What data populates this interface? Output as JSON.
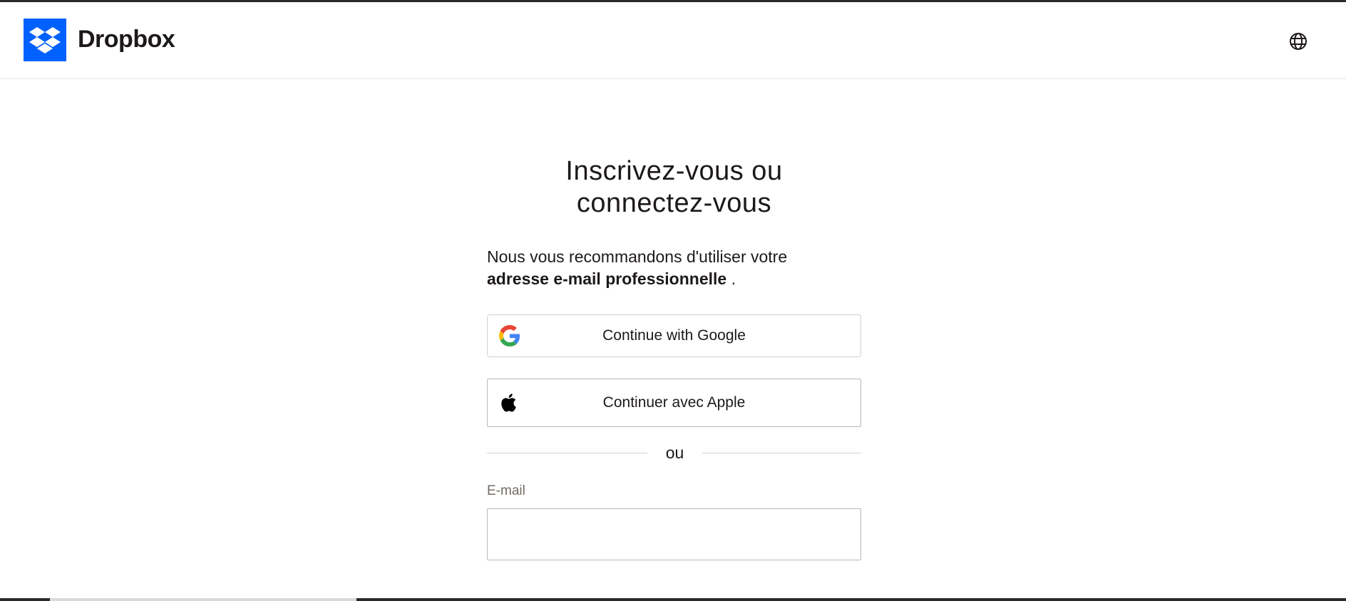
{
  "header": {
    "brand": "Dropbox",
    "logo_icon": "dropbox-logo-icon",
    "language_icon": "globe-icon",
    "brand_color": "#0061fe"
  },
  "main": {
    "title_line1": "Inscrivez-vous ou",
    "title_line2": "connectez-vous",
    "subtitle_regular": "Nous vous recommandons d'utiliser votre",
    "subtitle_bold": "adresse e-mail professionnelle",
    "subtitle_end": " .",
    "google_button": {
      "label": "Continue with Google",
      "icon": "google-icon"
    },
    "apple_button": {
      "label": "Continuer avec Apple",
      "icon": "apple-icon"
    },
    "divider_text": "ou",
    "email": {
      "label": "E-mail",
      "value": ""
    }
  }
}
